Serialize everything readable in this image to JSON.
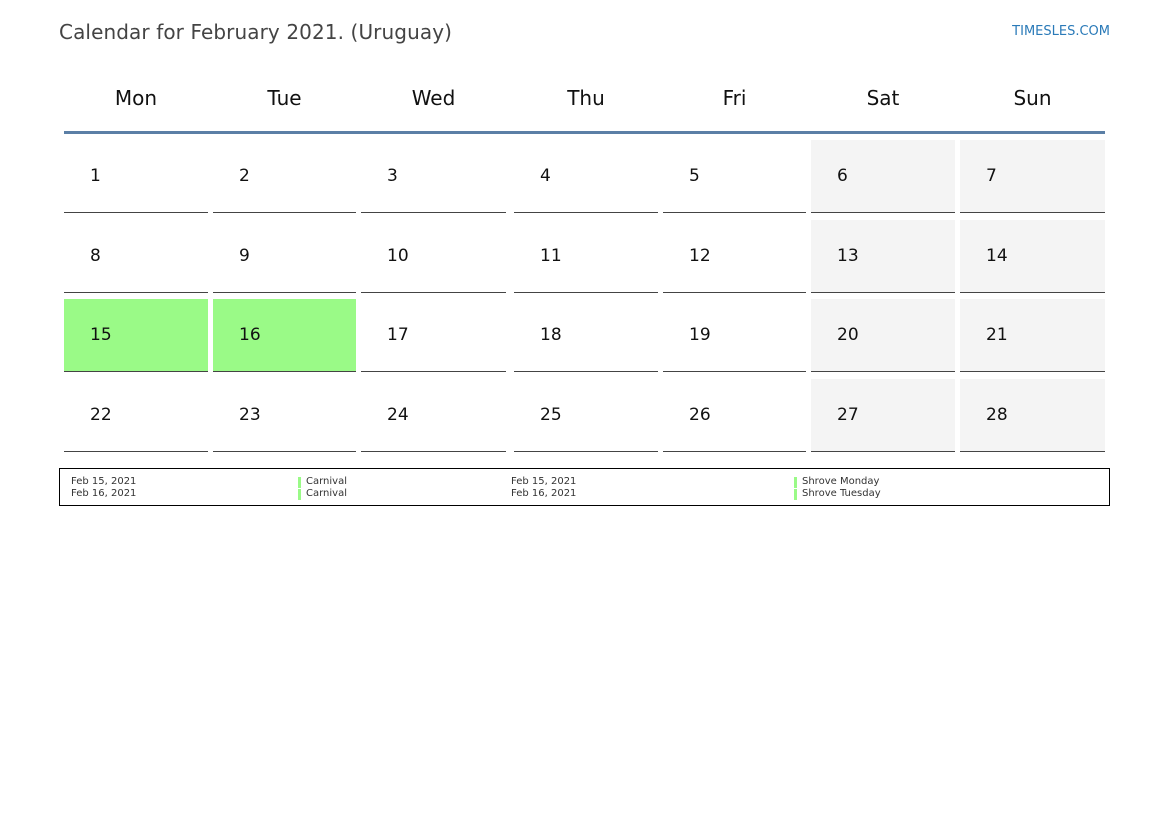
{
  "header": {
    "title": "Calendar for February 2021. (Uruguay)",
    "brand": "TIMESLES.COM"
  },
  "colors": {
    "holiday": "#9afa87",
    "weekend": "#f4f4f4",
    "header_rule": "#5b7fa6",
    "brand": "#2a7ab8"
  },
  "calendar": {
    "weekdays": [
      "Mon",
      "Tue",
      "Wed",
      "Thu",
      "Fri",
      "Sat",
      "Sun"
    ],
    "weeks": [
      [
        "1",
        "2",
        "3",
        "4",
        "5",
        "6",
        "7"
      ],
      [
        "8",
        "9",
        "10",
        "11",
        "12",
        "13",
        "14"
      ],
      [
        "15",
        "16",
        "17",
        "18",
        "19",
        "20",
        "21"
      ],
      [
        "22",
        "23",
        "24",
        "25",
        "26",
        "27",
        "28"
      ]
    ],
    "holiday_days": [
      "15",
      "16"
    ]
  },
  "legend": {
    "columns": [
      {
        "entries": [
          {
            "date": "Feb 15, 2021",
            "name": "Carnival"
          },
          {
            "date": "Feb 16, 2021",
            "name": "Carnival"
          }
        ]
      },
      {
        "entries": [
          {
            "date": "Feb 15, 2021",
            "name": "Shrove Monday"
          },
          {
            "date": "Feb 16, 2021",
            "name": "Shrove Tuesday"
          }
        ]
      }
    ]
  }
}
